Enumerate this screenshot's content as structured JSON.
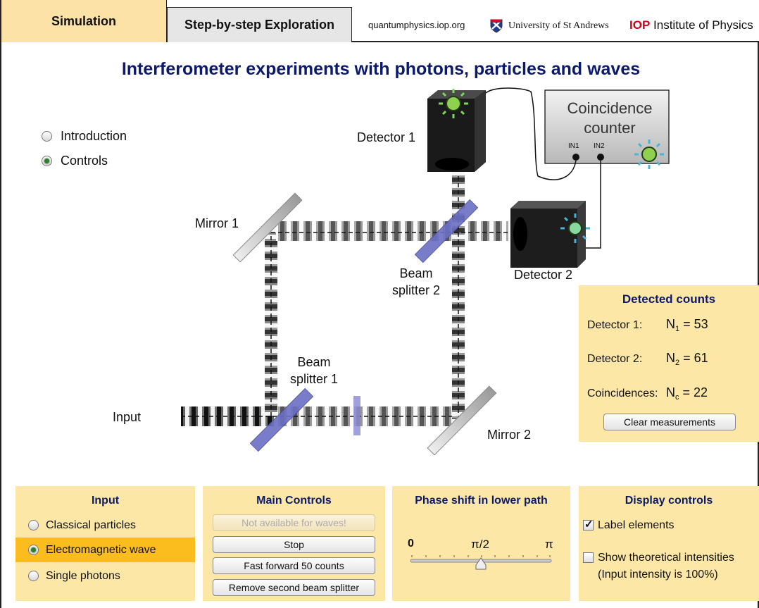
{
  "header": {
    "tab_simulation": "Simulation",
    "tab_step": "Step-by-step Exploration",
    "site": "quantumphysics.iop.org",
    "university": "University of St Andrews",
    "iop_mark": "IOP",
    "iop_name": "Institute of Physics"
  },
  "title": "Interferometer experiments with photons, particles and waves",
  "nav": {
    "items": [
      {
        "label": "Introduction",
        "selected": false
      },
      {
        "label": "Controls",
        "selected": true
      }
    ]
  },
  "diagram": {
    "detector1": "Detector 1",
    "detector2": "Detector 2",
    "counter_line1": "Coincidence",
    "counter_line2": "counter",
    "in1": "IN1",
    "in2": "IN2",
    "mirror1": "Mirror 1",
    "mirror2": "Mirror 2",
    "bs2_line1": "Beam",
    "bs2_line2": "splitter 2",
    "bs1_line1": "Beam",
    "bs1_line2": "splitter 1",
    "input": "Input"
  },
  "counts": {
    "title": "Detected counts",
    "d1_label": "Detector 1:",
    "d1_sym": "N",
    "d1_sub": "1",
    "d1_value": "= 53",
    "d2_label": "Detector 2:",
    "d2_sym": "N",
    "d2_sub": "2",
    "d2_value": "= 61",
    "c_label": "Coincidences:",
    "c_sym": "N",
    "c_sub": "c",
    "c_value": "= 22",
    "clear_button": "Clear measurements"
  },
  "input_panel": {
    "title": "Input",
    "options": [
      {
        "label": "Classical particles",
        "selected": false
      },
      {
        "label": "Electromagnetic wave",
        "selected": true
      },
      {
        "label": "Single photons",
        "selected": false
      }
    ]
  },
  "main_controls": {
    "title": "Main Controls",
    "not_available": "Not available for waves!",
    "stop": "Stop",
    "fast_forward": "Fast forward 50 counts",
    "remove_bs2": "Remove second beam splitter"
  },
  "phase": {
    "title": "Phase shift in lower path",
    "label_min": "0",
    "label_mid": "π/2",
    "label_max": "π",
    "value_fraction": 0.5
  },
  "display": {
    "title": "Display controls",
    "label_elements": "Label elements",
    "label_elements_checked": true,
    "show_theory": "Show theoretical intensities",
    "show_theory_note": "(Input intensity is 100%)",
    "show_theory_checked": false
  },
  "colors": {
    "panel": "#fde7a7",
    "selected_option": "#fbbd1e",
    "title": "#0b1a6b",
    "beam_splitter": "#6b6fc4",
    "led_green": "#7ed957"
  }
}
